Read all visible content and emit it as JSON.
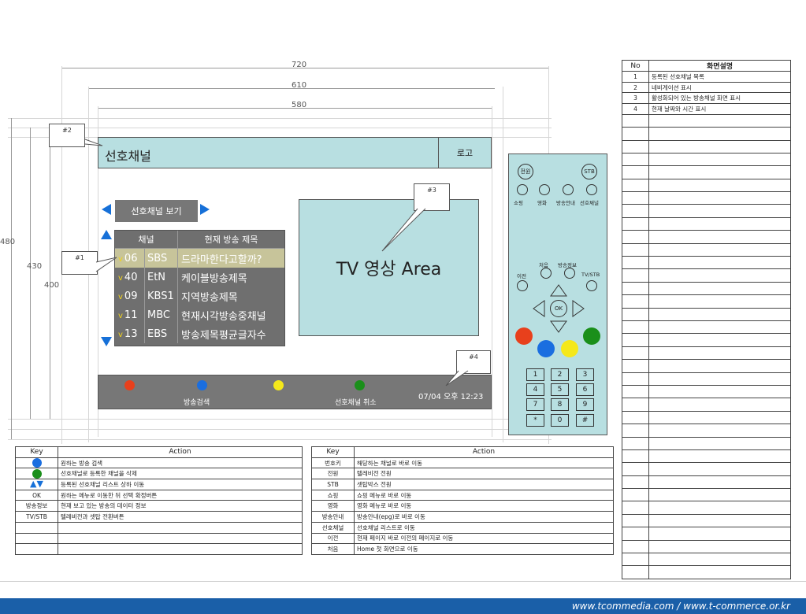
{
  "dimensions": {
    "w720": "720",
    "w610": "610",
    "w580": "580",
    "h480": "480",
    "h430": "430",
    "h400": "400"
  },
  "callouts": {
    "c1": "#1",
    "c2": "#2",
    "c3": "#3",
    "c4": "#4"
  },
  "screen": {
    "title": "선호채널",
    "logo": "로고",
    "nav_label": "선호채널 보기",
    "table_headers": [
      "채널",
      "현재 방송 제목"
    ],
    "check_mark": "v",
    "channels": [
      {
        "num": "06",
        "name": "SBS",
        "title": "드라마한다고할까?"
      },
      {
        "num": "40",
        "name": "EtN",
        "title": "케이블방송제목"
      },
      {
        "num": "09",
        "name": "KBS1",
        "title": "지역방송제목"
      },
      {
        "num": "11",
        "name": "MBC",
        "title": "현재시각방송중채널"
      },
      {
        "num": "13",
        "name": "EBS",
        "title": "방송제목평균글자수"
      }
    ],
    "tv_area": "TV 영상 Area",
    "bottom": {
      "blue_label": "방송검색",
      "green_label": "선호채널 취소",
      "datetime": "07/04 오후 12:23"
    }
  },
  "remote": {
    "power": "전원",
    "stb": "STB",
    "labels_row": [
      "쇼핑",
      "영화",
      "방송안내",
      "선호채널"
    ],
    "first": "처음",
    "info": "방송정보",
    "prev": "이전",
    "tvstb": "TV/STB",
    "ok": "OK",
    "numbers": [
      "1",
      "2",
      "3",
      "4",
      "5",
      "6",
      "7",
      "8",
      "9",
      "*",
      "0",
      "#"
    ]
  },
  "colors": {
    "red": "#e8401c",
    "blue": "#1a6ee0",
    "yellow": "#f5e81a",
    "green": "#1a8f1a"
  },
  "key_table_left": {
    "headers": [
      "Key",
      "Action"
    ],
    "rows": [
      {
        "key": "",
        "key_icon": "blue-circle-icon",
        "action": "원하는 방송 검색"
      },
      {
        "key": "",
        "key_icon": "green-circle-icon",
        "action": "선호채널로 등록한 채널을 삭제"
      },
      {
        "key": "",
        "key_icon": "up-down-arrows-icon",
        "action": "등록된 선호채널 리스트 상하 이동"
      },
      {
        "key": "OK",
        "action": "원하는 메뉴로 이동한 뒤 선택 확정버튼"
      },
      {
        "key": "방송정보",
        "action": "현재 보고 있는 방송의 데이터 정보"
      },
      {
        "key": "TV/STB",
        "action": "텔레비전과 셋탑 전환버튼"
      },
      {
        "key": "",
        "action": ""
      },
      {
        "key": "",
        "action": ""
      },
      {
        "key": "",
        "action": ""
      }
    ]
  },
  "key_table_right": {
    "headers": [
      "Key",
      "Action"
    ],
    "rows": [
      {
        "key": "번호키",
        "action": "해당하는 채널로 바로 이동"
      },
      {
        "key": "전원",
        "action": "텔레비전 전원"
      },
      {
        "key": "STB",
        "action": "셋탑박스 전원"
      },
      {
        "key": "쇼핑",
        "action": "쇼핑 메뉴로 바로 이동"
      },
      {
        "key": "영화",
        "action": "영화 메뉴로 바로 이동"
      },
      {
        "key": "방송안내",
        "action": "방송안내(epg)로 바로 이동"
      },
      {
        "key": "선호채널",
        "action": "선호채널 리스트로 이동"
      },
      {
        "key": "이전",
        "action": "현재 페이지 바로 이전의 페이지로 이동"
      },
      {
        "key": "처음",
        "action": "Home 첫 화면으로 이동"
      }
    ]
  },
  "desc_table": {
    "headers": [
      "No",
      "화면설명"
    ],
    "rows": [
      {
        "no": "1",
        "text": "등록된 선호채널 목록"
      },
      {
        "no": "2",
        "text": "네비게이션 표시"
      },
      {
        "no": "3",
        "text": "활성화되어 있는 방송채널 화면 표시"
      },
      {
        "no": "4",
        "text": "현재 날짜와 시간 표시"
      }
    ],
    "empty_rows": 36
  },
  "footer": "www.tcommedia.com / www.t-commerce.or.kr"
}
